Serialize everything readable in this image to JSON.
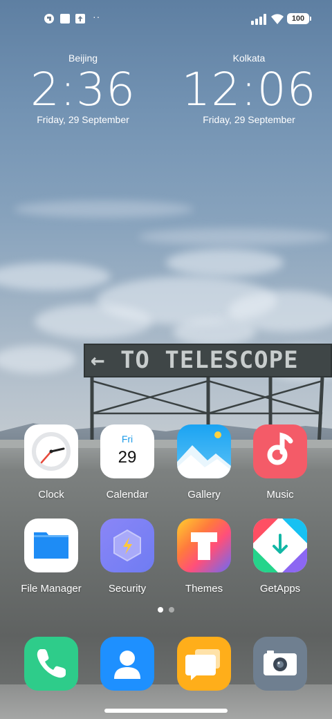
{
  "status_bar": {
    "notification_icons": [
      "app-notification-icon",
      "square-notification-icon",
      "upload-arrow-icon"
    ],
    "more_dots": "··",
    "signal_icon": "signal-bars-icon",
    "wifi_icon": "wifi-icon",
    "battery": "100"
  },
  "clocks": [
    {
      "city": "Beijing",
      "time": "2:36",
      "date": "Friday, 29 September"
    },
    {
      "city": "Kolkata",
      "time": "12:06",
      "date": "Friday, 29 September"
    }
  ],
  "wallpaper": {
    "sign_text": "← TO TELESCOPE"
  },
  "apps_row1": [
    {
      "label": "Clock",
      "icon": "clock-icon"
    },
    {
      "label": "Calendar",
      "icon": "calendar-icon",
      "day": "Fri",
      "date": "29"
    },
    {
      "label": "Gallery",
      "icon": "gallery-icon"
    },
    {
      "label": "Music",
      "icon": "music-icon"
    }
  ],
  "apps_row2": [
    {
      "label": "File Manager",
      "icon": "folder-icon"
    },
    {
      "label": "Security",
      "icon": "security-shield-icon"
    },
    {
      "label": "Themes",
      "icon": "themes-icon"
    },
    {
      "label": "GetApps",
      "icon": "getapps-icon"
    }
  ],
  "page_indicator": {
    "pages": 2,
    "current": 1
  },
  "dock": [
    {
      "name": "Phone",
      "icon": "phone-icon"
    },
    {
      "name": "Contacts",
      "icon": "contacts-icon"
    },
    {
      "name": "Messaging",
      "icon": "messages-icon"
    },
    {
      "name": "Camera",
      "icon": "camera-icon"
    }
  ],
  "colors": {
    "music": "#f45b68",
    "files": "#1e8cf5",
    "security": "#7b7ff5",
    "phone": "#2ecc8a",
    "contacts": "#1e90ff",
    "messages": "#ffae1a",
    "camera": "#6f7f90"
  }
}
